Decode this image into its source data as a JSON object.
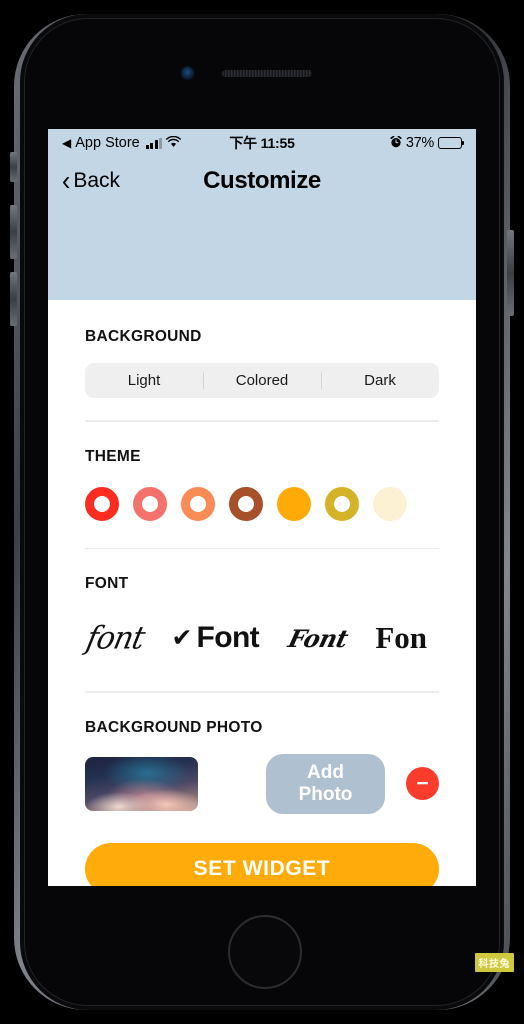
{
  "status_bar": {
    "back_arrow": "◀",
    "carrier_app": "App Store",
    "signal_icon": "signal-bars",
    "wifi_icon": "▼",
    "time": "下午 11:55",
    "alarm_icon": "⏰",
    "battery_percent": "37%",
    "battery_level": 27
  },
  "nav": {
    "back_chevron": "‹",
    "back_label": "Back",
    "title": "Customize"
  },
  "sections": {
    "background": {
      "label": "BACKGROUND",
      "options": [
        "Light",
        "Colored",
        "Dark"
      ],
      "selected": "Light"
    },
    "theme": {
      "label": "THEME",
      "swatches": [
        {
          "name": "red",
          "color": "#fa2d20",
          "style": "ring"
        },
        {
          "name": "salmon",
          "color": "#f4726c",
          "style": "ring"
        },
        {
          "name": "light-orange",
          "color": "#f98b55",
          "style": "ring"
        },
        {
          "name": "brown",
          "color": "#a8502a",
          "style": "ring"
        },
        {
          "name": "orange",
          "color": "#ffaa06",
          "style": "solid"
        },
        {
          "name": "gold",
          "color": "#d4b327",
          "style": "ring"
        },
        {
          "name": "cream",
          "color": "#fdf1d4",
          "style": "solid"
        }
      ],
      "selected": "orange"
    },
    "font": {
      "label": "FONT",
      "options": [
        {
          "name": "script",
          "sample": "font",
          "selected": false
        },
        {
          "name": "sans",
          "sample": "Font",
          "selected": true
        },
        {
          "name": "brush",
          "sample": "Font",
          "selected": false
        },
        {
          "name": "serif",
          "sample": "Fon",
          "selected": false
        }
      ],
      "check_mark": "✔"
    },
    "background_photo": {
      "label": "BACKGROUND PHOTO",
      "add_label": "Add Photo",
      "remove_label": "−"
    }
  },
  "footer": {
    "set_widget_label": "SET WIDGET"
  },
  "watermark": "科技兔",
  "colors": {
    "screen_bg": "#c3d6e6",
    "accent": "#ffab09",
    "danger": "#fa3c2d",
    "add_photo": "#afc0d0"
  }
}
